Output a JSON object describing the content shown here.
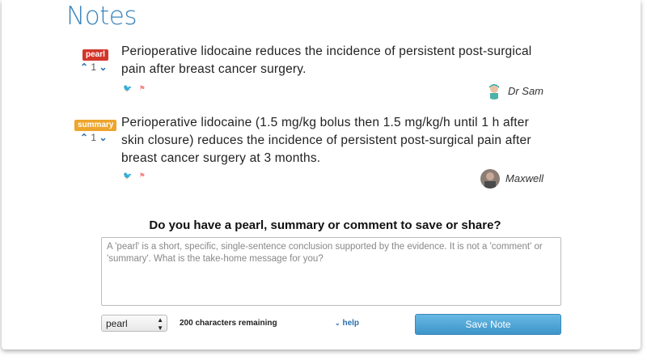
{
  "section_title": "Notes",
  "notes": [
    {
      "badge": "pearl",
      "votes": "1",
      "text": "Perioperative lidocaine reduces the incidence of persistent post-surgical pain after breast cancer surgery.",
      "author": "Dr Sam"
    },
    {
      "badge": "summary",
      "votes": "1",
      "text": "Perioperative lidocaine (1.5 mg/kg bolus then 1.5 mg/kg/h until 1 h after skin closure) reduces the incidence of persistent post-surgical pain after breast cancer surgery at 3 months.",
      "author": "Maxwell"
    }
  ],
  "form": {
    "prompt": "Do you have a pearl, summary or comment to save or share?",
    "placeholder": "A 'pearl' is a short, specific, single-sentence conclusion supported by the evidence. It is not a 'comment' or 'summary'. What is the take-home message for you?",
    "type_value": "pearl",
    "chars_remaining": "200 characters remaining",
    "help_label": "help",
    "save_label": "Save Note"
  },
  "colors": {
    "accent": "#3b86bd",
    "pearl_badge": "#d3352b",
    "summary_badge": "#eda52d",
    "button": "#4aa3d6"
  }
}
